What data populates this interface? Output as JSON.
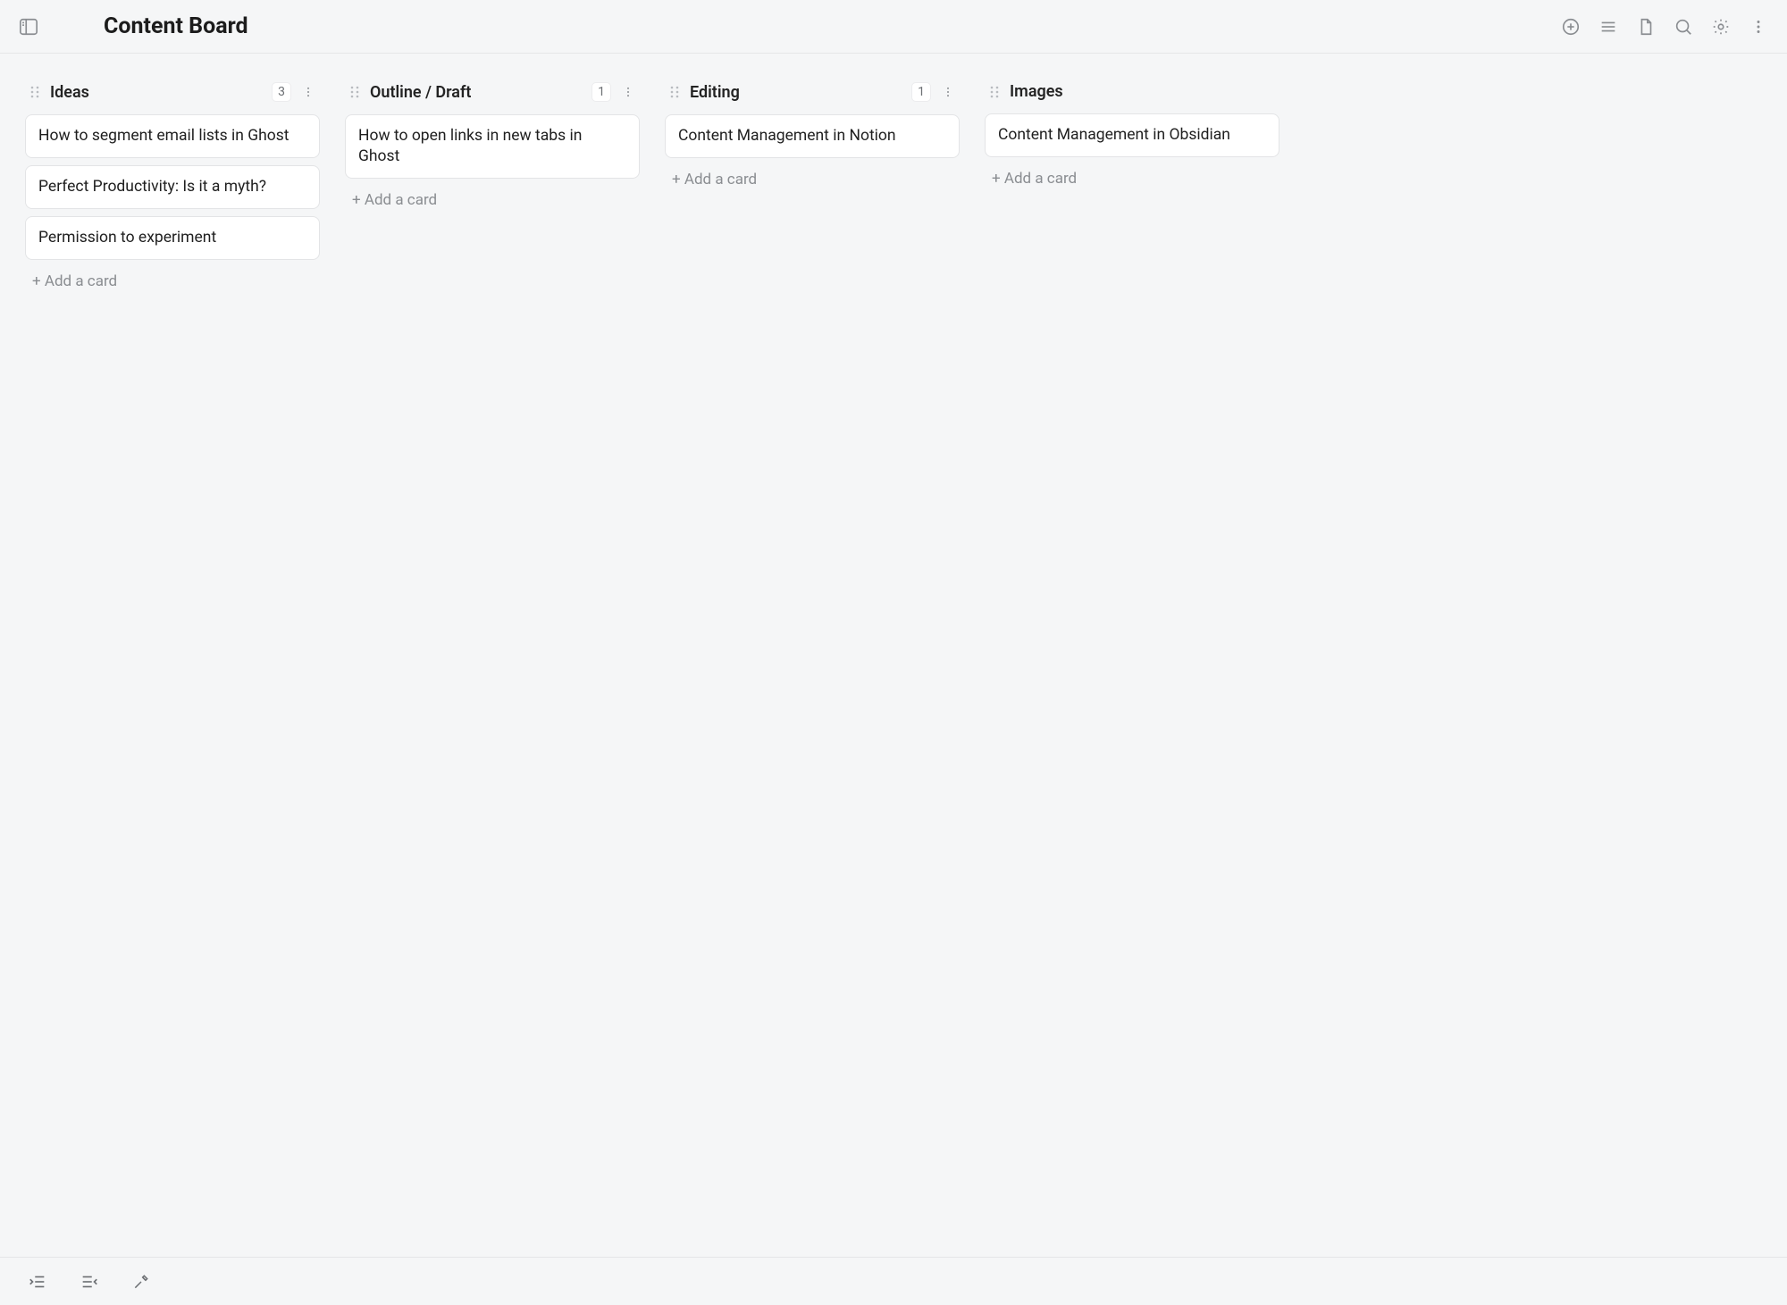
{
  "header": {
    "title": "Content Board"
  },
  "add_card_label": "+ Add a card",
  "columns": [
    {
      "title": "Ideas",
      "count": "3",
      "show_count": true,
      "show_menu": true,
      "cards": [
        "How to segment email lists in Ghost",
        "Perfect Productivity: Is it a myth?",
        "Permission to experiment"
      ]
    },
    {
      "title": "Outline / Draft",
      "count": "1",
      "show_count": true,
      "show_menu": true,
      "cards": [
        "How to open links in new tabs in Ghost"
      ]
    },
    {
      "title": "Editing",
      "count": "1",
      "show_count": true,
      "show_menu": true,
      "cards": [
        "Content Management in Notion"
      ]
    },
    {
      "title": "Images",
      "count": "",
      "show_count": false,
      "show_menu": false,
      "cards": [
        "Content Management in Obsidian"
      ]
    }
  ]
}
